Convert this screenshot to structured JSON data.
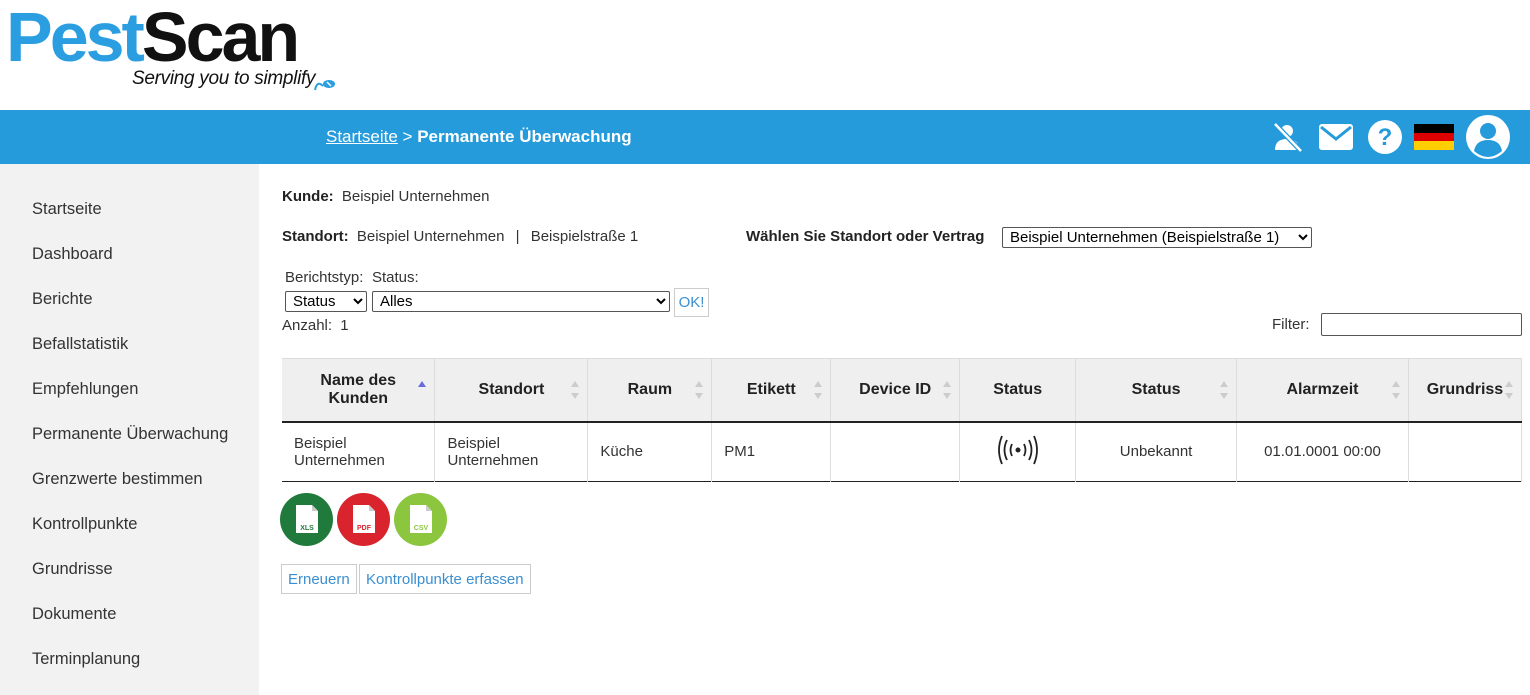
{
  "logo": {
    "part1": "Pest",
    "part2": "Scan",
    "tagline": "Serving you to simplify"
  },
  "breadcrumb": {
    "home": "Startseite",
    "separator": " > ",
    "current": "Permanente Überwachung"
  },
  "top_icons": [
    "person-off-icon",
    "mail-icon",
    "help-icon",
    "german-flag-icon",
    "user-avatar-icon"
  ],
  "colors": {
    "topbar": "#259bdb",
    "sidebar": "#f2f2f2",
    "link": "#3b8fd1"
  },
  "sidebar": {
    "items": [
      {
        "label": "Startseite"
      },
      {
        "label": "Dashboard"
      },
      {
        "label": "Berichte"
      },
      {
        "label": "Befallstatistik"
      },
      {
        "label": "Empfehlungen"
      },
      {
        "label": "Permanente Überwachung"
      },
      {
        "label": "Grenzwerte bestimmen"
      },
      {
        "label": "Kontrollpunkte"
      },
      {
        "label": "Grundrisse"
      },
      {
        "label": "Dokumente"
      },
      {
        "label": "Terminplanung"
      }
    ]
  },
  "customer": {
    "label": "Kunde:",
    "value": "Beispiel Unternehmen"
  },
  "location": {
    "label": "Standort:",
    "name": "Beispiel Unternehmen",
    "separator": "|",
    "street": "Beispielstraße 1"
  },
  "location_select": {
    "label": "Wählen Sie Standort oder Vertrag",
    "value": "Beispiel Unternehmen (Beispielstraße 1)"
  },
  "filters": {
    "report_type_label": "Berichtstyp:",
    "status_label": "Status:",
    "report_type_value": "Status",
    "status_value": "Alles",
    "ok_label": "OK!",
    "count_label": "Anzahl:",
    "count_value": "1",
    "filter_label": "Filter:"
  },
  "table": {
    "headers": [
      "Name des Kunden",
      "Standort",
      "Raum",
      "Etikett",
      "Device ID",
      "Status",
      "Status",
      "Alarmzeit",
      "Grundriss"
    ],
    "rows": [
      {
        "customer": "Beispiel Unternehmen",
        "location": "Beispiel Unternehmen",
        "room": "Küche",
        "label": "PM1",
        "device_id": "",
        "status_icon": "wireless-signal-icon",
        "status": "Unbekannt",
        "alarm_time": "01.01.0001 00:00",
        "floorplan": ""
      }
    ]
  },
  "exports": [
    {
      "label": "XLS",
      "color": "#1f7a3c"
    },
    {
      "label": "PDF",
      "color": "#d9232d"
    },
    {
      "label": "CSV",
      "color": "#8cc63f"
    }
  ],
  "actions": {
    "refresh": "Erneuern",
    "capture": "Kontrollpunkte erfassen"
  }
}
